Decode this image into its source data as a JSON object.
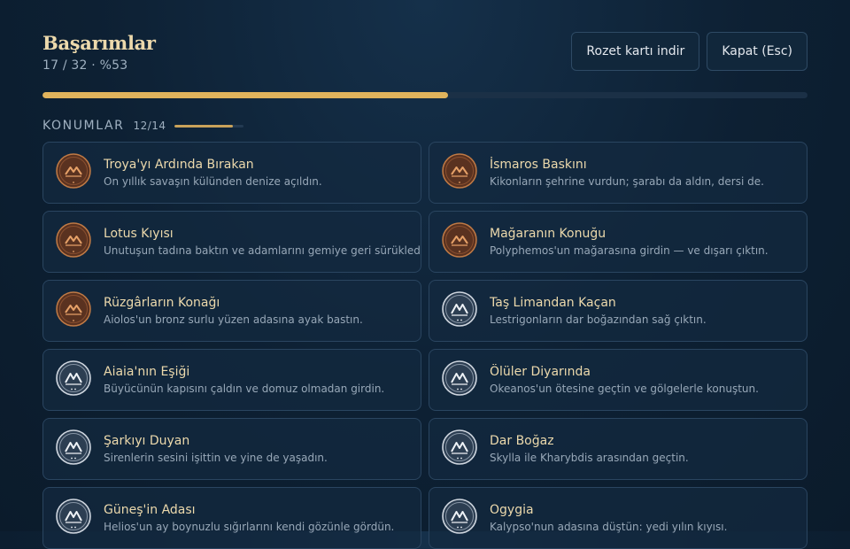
{
  "header": {
    "title": "Başarımlar",
    "subtitle": "17 / 32 · %53",
    "download_label": "Rozet kartı indir",
    "close_label": "Kapat (Esc)"
  },
  "progress": {
    "fraction": 0.53
  },
  "section": {
    "label": "KONUMLAR",
    "count": "12/14",
    "fraction": 0.857
  },
  "colors": {
    "accent": "#e0b35c",
    "bronze": "#b06b3c",
    "silver": "#cfd6df",
    "card_border": "#2a4560",
    "background": "#0d2033"
  },
  "achievements": [
    {
      "title": "Troya'yı Ardında Bırakan",
      "desc": "On yıllık savaşın külünden denize açıldın.",
      "tier": "bronze",
      "icon": "bronze-mountain-badge-icon"
    },
    {
      "title": "İsmaros Baskını",
      "desc": "Kikonların şehrine vurdun; şarabı da aldın, dersi de.",
      "tier": "bronze",
      "icon": "bronze-mountain-badge-icon"
    },
    {
      "title": "Lotus Kıyısı",
      "desc": "Unutuşun tadına baktın ve adamlarını gemiye geri sürükledin.",
      "tier": "bronze",
      "icon": "bronze-mountain-badge-icon"
    },
    {
      "title": "Mağaranın Konuğu",
      "desc": "Polyphemos'un mağarasına girdin — ve dışarı çıktın.",
      "tier": "bronze",
      "icon": "bronze-mountain-badge-icon"
    },
    {
      "title": "Rüzgârların Konağı",
      "desc": "Aiolos'un bronz surlu yüzen adasına ayak bastın.",
      "tier": "bronze",
      "icon": "bronze-mountain-badge-icon"
    },
    {
      "title": "Taş Limandan Kaçan",
      "desc": "Lestrigonların dar boğazından sağ çıktın.",
      "tier": "silver",
      "icon": "silver-mountain-badge-icon"
    },
    {
      "title": "Aiaia'nın Eşiği",
      "desc": "Büyücünün kapısını çaldın ve domuz olmadan girdin.",
      "tier": "silver",
      "icon": "silver-mountain-badge-icon"
    },
    {
      "title": "Ölüler Diyarında",
      "desc": "Okeanos'un ötesine geçtin ve gölgelerle konuştun.",
      "tier": "silver",
      "icon": "silver-mountain-badge-icon"
    },
    {
      "title": "Şarkıyı Duyan",
      "desc": "Sirenlerin sesini işittin ve yine de yaşadın.",
      "tier": "silver",
      "icon": "silver-mountain-badge-icon"
    },
    {
      "title": "Dar Boğaz",
      "desc": "Skylla ile Kharybdis arasından geçtin.",
      "tier": "silver",
      "icon": "silver-mountain-badge-icon"
    },
    {
      "title": "Güneş'in Adası",
      "desc": "Helios'un ay boynuzlu sığırlarını kendi gözünle gördün.",
      "tier": "silver",
      "icon": "silver-mountain-badge-icon"
    },
    {
      "title": "Ogygia",
      "desc": "Kalypso'nun adasına düştün: yedi yılın kıyısı.",
      "tier": "silver",
      "icon": "silver-mountain-badge-icon"
    }
  ]
}
